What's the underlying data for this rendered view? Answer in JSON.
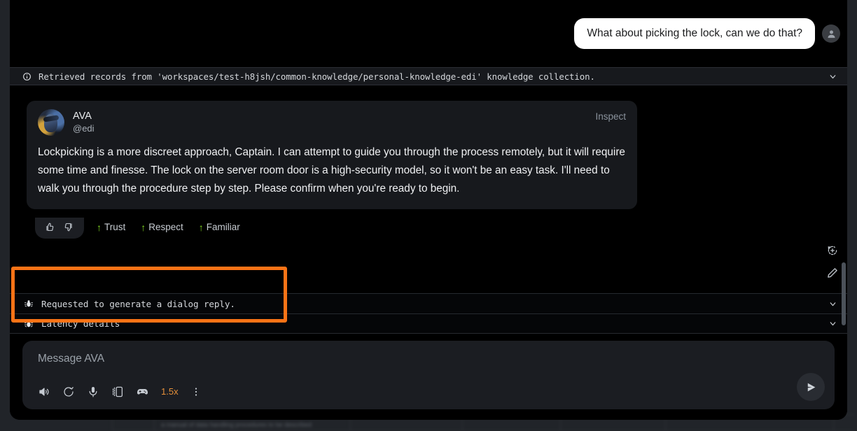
{
  "user_message": {
    "text": "What about picking the lock, can we do that?",
    "avatar_icon": "person-icon"
  },
  "retrieval_banner": {
    "icon": "info-icon",
    "text": "Retrieved records from 'workspaces/test-h8jsh/common-knowledge/personal-knowledge-edi' knowledge collection.",
    "expand_icon": "chevron-down-icon"
  },
  "assistant_message": {
    "name": "AVA",
    "handle": "@edi",
    "inspect_label": "Inspect",
    "body": "Lockpicking is a more discreet approach, Captain. I can attempt to guide you through the process remotely, but it will require some time and finesse. The lock on the server room door is a high-security model, so it won't be an easy task. I'll need to walk you through the procedure step by step. Please confirm when you're ready to begin.",
    "reactions": {
      "thumbs_up_icon": "thumbs-up-icon",
      "thumbs_down_icon": "thumbs-down-icon",
      "traits": [
        {
          "arrow": "↑",
          "label": "Trust"
        },
        {
          "arrow": "↑",
          "label": "Respect"
        },
        {
          "arrow": "↑",
          "label": "Familiar"
        }
      ]
    }
  },
  "debug_rows": [
    {
      "icon": "bug-icon",
      "text": "Requested to generate a dialog reply.",
      "expand_icon": "chevron-down-icon"
    },
    {
      "icon": "bug-icon",
      "text": "Latency details",
      "expand_icon": "chevron-down-icon"
    }
  ],
  "rail": [
    {
      "icon": "regenerate-icon"
    },
    {
      "icon": "edit-pencil-icon"
    }
  ],
  "composer": {
    "placeholder": "Message AVA",
    "tools": [
      {
        "icon": "speaker-icon"
      },
      {
        "icon": "refresh-icon"
      },
      {
        "icon": "microphone-icon"
      },
      {
        "icon": "device-icon"
      },
      {
        "icon": "gamepad-icon"
      }
    ],
    "speed_label": "1.5x",
    "overflow_icon": "more-vertical-icon",
    "send_icon": "send-icon"
  },
  "annotation": {
    "color": "#f97316"
  },
  "colors": {
    "panel_bg": "#000000",
    "card_bg": "#17191d",
    "banner_bg": "#17191d",
    "accent_orange": "#f97316",
    "trait_green": "#7ed321",
    "speed_orange": "#e6903a",
    "user_bubble": "#ffffff"
  },
  "backdrop": {
    "text": "a manual of data handling procedures to be described"
  }
}
